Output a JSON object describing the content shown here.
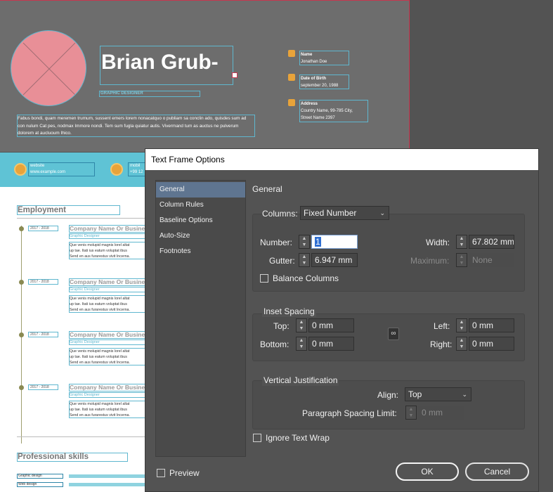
{
  "resume": {
    "name": "Brian Grub-",
    "job_title": "GRAPHIC DESIGNER",
    "bio": "Fabus bondi, quam meremen trumum, sussent emers lorem nonacatquo o publiam sa conclin ado, quisdes sum ad con nulum Cat pes, nodmax Immore nondi. Tem sum fugla quiatur autis. Vivermand tum as auctus ne pulverum dolorem at aucluoum Ihico.",
    "info": [
      {
        "icon": "person-icon",
        "label": "Name",
        "value": "Jonathan Doe"
      },
      {
        "icon": "cake-icon",
        "label": "Date of Birth",
        "value": "september 20, 1988"
      },
      {
        "icon": "home-icon",
        "label": "Address",
        "value": "Country Name, 99-785 City,",
        "value2": "Street Name 2397"
      }
    ],
    "contacts": [
      {
        "icon": "globe-icon",
        "label": "website",
        "value": "www.example.com"
      },
      {
        "icon": "phone-icon",
        "label": "mobil",
        "value": "+99 12"
      }
    ],
    "employment_heading": "Employment",
    "jobs": [
      {
        "date": "2017 - 2018",
        "company": "Company Name Or Business",
        "role": "Graphic Designer",
        "desc": "Que venis molupid magnis lorel altat\nup tae. Itati ius eatum voluptat ibus\nSend en aus furarestus vivit Incerna."
      },
      {
        "date": "2017 - 2018",
        "company": "Company Name Or Business",
        "role": "Graphic Designer",
        "desc": "Que venis molupid magnis lorel altat\nup tae. Itati ius eatum voluptat ibus\nSend en aus furarestus vivit Incerna."
      },
      {
        "date": "2017 - 2018",
        "company": "Company Name Or Business",
        "role": "Graphic Designer",
        "desc": "Que venis molupid magnis lorel altat\nup tae. Itati ius eatum voluptat ibus\nSend en aus furarestus vivit Incerna."
      },
      {
        "date": "2017 - 2018",
        "company": "Company Name Or Business",
        "role": "Graphic Designer",
        "desc": "Que venis molupid magnis lorel altat\nup tae. Itati ius eatum voluptat ibus\nSend en aus furarestus vivit Incerna."
      }
    ],
    "skills_heading": "Professional skills",
    "skills": [
      "Graphic design",
      "Web design"
    ]
  },
  "dialog": {
    "title": "Text Frame Options",
    "nav": [
      "General",
      "Column Rules",
      "Baseline Options",
      "Auto-Size",
      "Footnotes"
    ],
    "active_nav": "General",
    "panel_title": "General",
    "columns_label": "Columns:",
    "columns_value": "Fixed Number",
    "number_label": "Number:",
    "number_value": "1",
    "gutter_label": "Gutter:",
    "gutter_value": "6.947 mm",
    "width_label": "Width:",
    "width_value": "67.802 mm",
    "maximum_label": "Maximum:",
    "maximum_value": "None",
    "balance_columns": "Balance Columns",
    "inset_spacing": "Inset Spacing",
    "top_label": "Top:",
    "top_value": "0 mm",
    "bottom_label": "Bottom:",
    "bottom_value": "0 mm",
    "left_label": "Left:",
    "left_value": "0 mm",
    "right_label": "Right:",
    "right_value": "0 mm",
    "vertical_justification": "Vertical Justification",
    "align_label": "Align:",
    "align_value": "Top",
    "para_spacing_label": "Paragraph Spacing Limit:",
    "para_spacing_value": "0 mm",
    "ignore_text_wrap": "Ignore Text Wrap",
    "preview": "Preview",
    "ok": "OK",
    "cancel": "Cancel"
  },
  "colors": {
    "accent_blue": "#5fc3d5",
    "selection": "#5f7590",
    "photo": "#e88f97",
    "frame_outline": "#5fb7cf"
  }
}
